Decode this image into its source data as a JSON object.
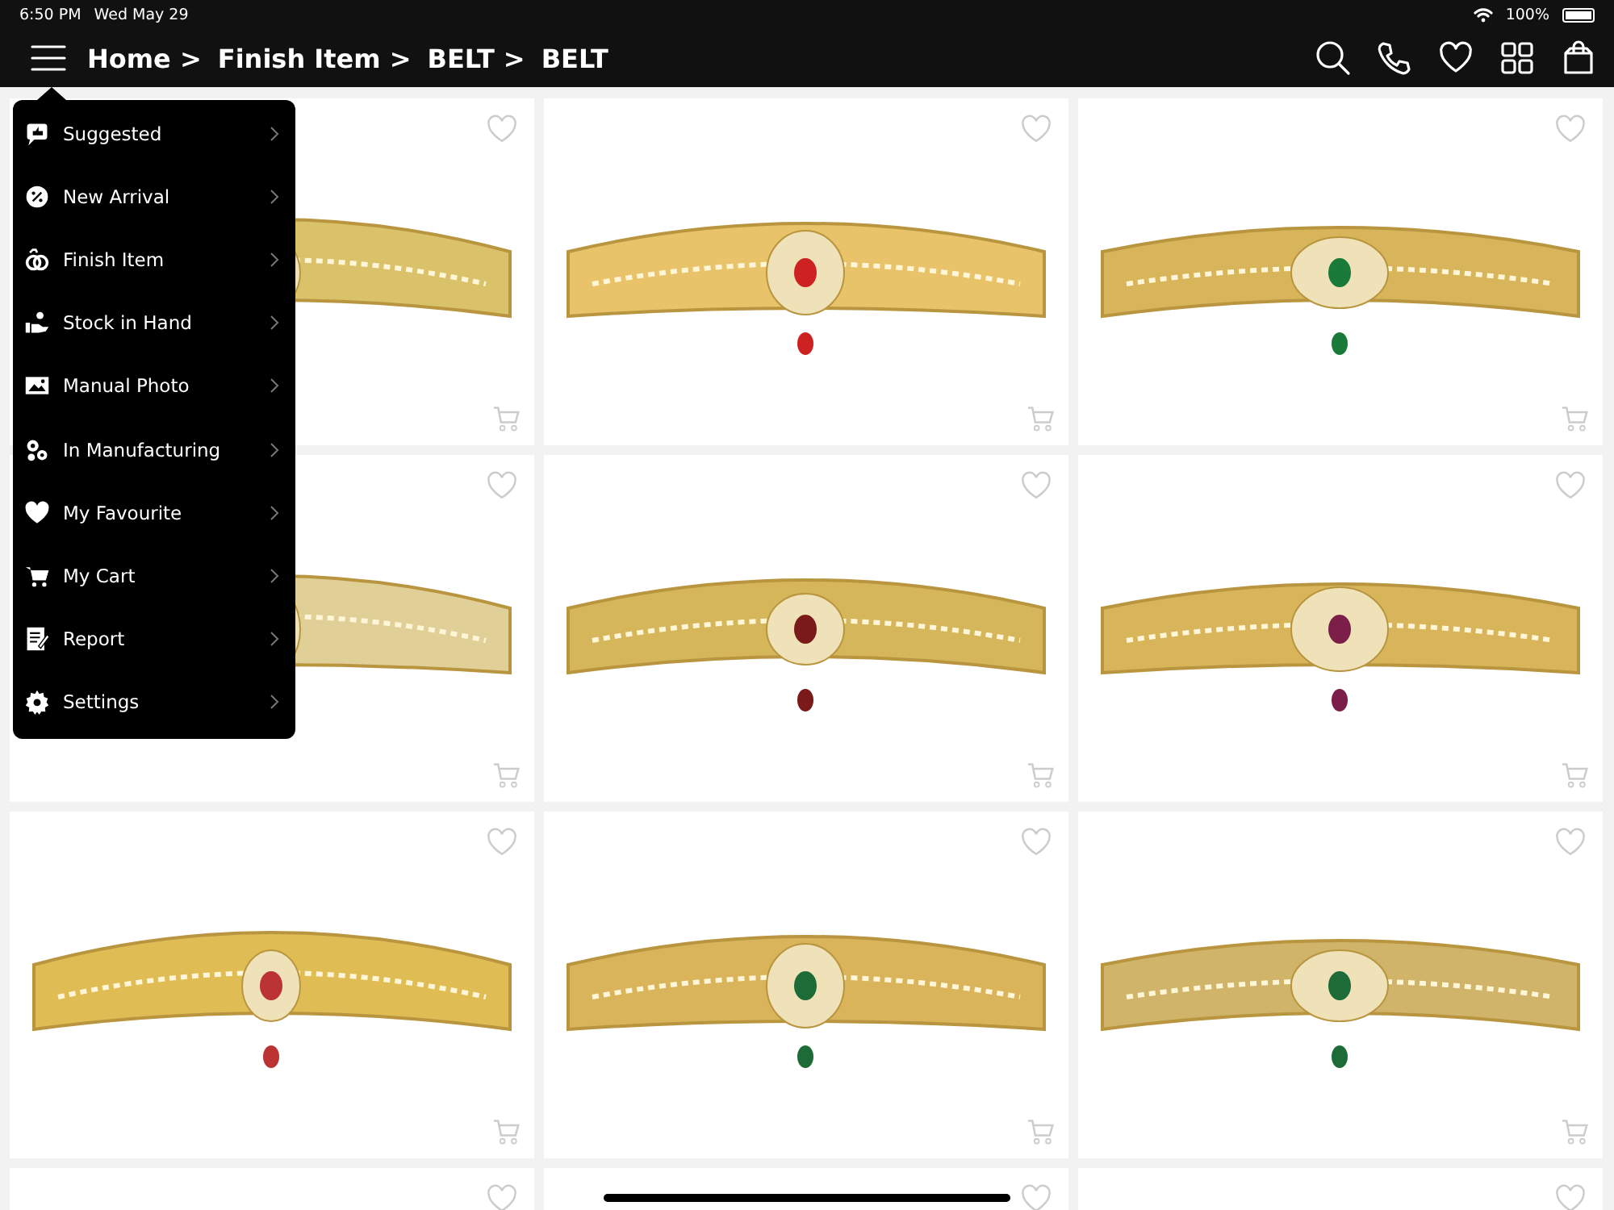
{
  "status_bar": {
    "time": "6:50 PM",
    "date": "Wed May 29",
    "battery": "100%"
  },
  "breadcrumb": [
    "Home >",
    "Finish Item >",
    "BELT >",
    "BELT"
  ],
  "menu": {
    "open": true,
    "items": [
      {
        "label": "Suggested"
      },
      {
        "label": "New Arrival"
      },
      {
        "label": "Finish Item"
      },
      {
        "label": "Stock in Hand"
      },
      {
        "label": "Manual Photo"
      },
      {
        "label": "In Manufacturing"
      },
      {
        "label": "My Favourite"
      },
      {
        "label": "My Cart"
      },
      {
        "label": "Report"
      },
      {
        "label": "Settings"
      }
    ]
  },
  "products": [
    {
      "favourite": false
    },
    {
      "favourite": false
    },
    {
      "favourite": false
    },
    {
      "favourite": false
    },
    {
      "favourite": false
    },
    {
      "favourite": false
    },
    {
      "favourite": false
    },
    {
      "favourite": false
    },
    {
      "favourite": false
    },
    {
      "favourite": false
    },
    {
      "favourite": false
    },
    {
      "favourite": false
    }
  ]
}
